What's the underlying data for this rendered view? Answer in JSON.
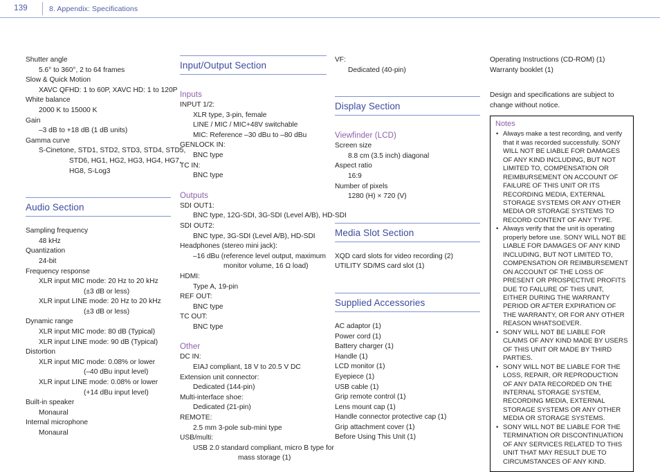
{
  "header": {
    "page_number": "139",
    "title": "8. Appendix: Specifications"
  },
  "column1": {
    "entries": [
      {
        "label": "Shutter angle",
        "values": [
          "5.6° to 360°, 2 to 64 frames"
        ]
      },
      {
        "label": "Slow & Quick Motion",
        "values": [
          "XAVC QFHD: 1 to 60P, XAVC HD: 1 to 120P"
        ]
      },
      {
        "label": "White balance",
        "values": [
          "2000 K to 15000 K"
        ]
      },
      {
        "label": "Gain",
        "values": [
          "–3 dB to +18 dB (1 dB units)"
        ]
      },
      {
        "label": "Gamma curve",
        "values": [
          "S-Cinetone, STD1, STD2, STD3, STD4, STD5,"
        ],
        "continuations": [
          "STD6, HG1, HG2, HG3, HG4, HG7,",
          "HG8, S-Log3"
        ]
      }
    ],
    "audio_section": {
      "heading": "Audio Section",
      "entries": [
        {
          "label": "Sampling frequency",
          "values": [
            "48 kHz"
          ]
        },
        {
          "label": "Quantization",
          "values": [
            "24-bit"
          ]
        },
        {
          "label": "Frequency response",
          "values": [
            "XLR input MIC mode: 20 Hz to 20 kHz"
          ],
          "continuations": [
            "(±3 dB or less)"
          ],
          "values2": [
            "XLR input LINE mode: 20 Hz to 20 kHz"
          ],
          "continuations2": [
            "(±3 dB or less)"
          ]
        },
        {
          "label": "Dynamic range",
          "values": [
            "XLR input MIC mode: 80 dB (Typical)",
            "XLR input LINE mode: 90 dB (Typical)"
          ]
        },
        {
          "label": "Distortion",
          "values": [
            "XLR input MIC mode: 0.08% or lower"
          ],
          "continuations": [
            "(–40 dBu input level)"
          ],
          "values2": [
            "XLR input LINE mode: 0.08% or lower"
          ],
          "continuations2": [
            "(+14 dBu input level)"
          ]
        },
        {
          "label": "Built-in speaker",
          "values": [
            "Monaural"
          ]
        },
        {
          "label": "Internal microphone",
          "values": [
            "Monaural"
          ]
        }
      ]
    }
  },
  "column2": {
    "heading": "Input/Output Section",
    "inputs": {
      "subheading": "Inputs",
      "entries": [
        {
          "label": "INPUT 1/2:",
          "values": [
            "XLR type, 3-pin, female",
            "LINE / MIC / MIC+48V switchable",
            "MIC: Reference –30 dBu to –80 dBu"
          ]
        },
        {
          "label": "GENLOCK IN:",
          "values": [
            "BNC type"
          ]
        },
        {
          "label": "TC IN:",
          "values": [
            "BNC type"
          ]
        }
      ]
    },
    "outputs": {
      "subheading": "Outputs",
      "entries": [
        {
          "label": "SDI OUT1:",
          "values": [
            "BNC type, 12G-SDI, 3G-SDI (Level A/B), HD-SDI"
          ]
        },
        {
          "label": "SDI OUT2:",
          "values": [
            "BNC type, 3G-SDI (Level A/B), HD-SDI"
          ]
        },
        {
          "label": "Headphones (stereo mini jack):",
          "values": [
            "–16 dBu (reference level output, maximum"
          ],
          "continuations": [
            "monitor volume, 16 Ω load)"
          ]
        },
        {
          "label": "HDMI:",
          "values": [
            "Type A, 19-pin"
          ]
        },
        {
          "label": "REF OUT:",
          "values": [
            "BNC type"
          ]
        },
        {
          "label": "TC OUT:",
          "values": [
            "BNC type"
          ]
        }
      ]
    },
    "other": {
      "subheading": "Other",
      "entries": [
        {
          "label": "DC IN:",
          "values": [
            "EIAJ compliant, 18 V to 20.5 V DC"
          ]
        },
        {
          "label": "Extension unit connector:",
          "values": [
            "Dedicated (144-pin)"
          ]
        },
        {
          "label": "Multi-interface shoe:",
          "values": [
            "Dedicated (21-pin)"
          ]
        },
        {
          "label": "REMOTE:",
          "values": [
            "2.5 mm 3-pole sub-mini type"
          ]
        },
        {
          "label": "USB/multi:",
          "values": [
            "USB 2.0 standard compliant, micro B type for"
          ],
          "continuations": [
            "mass storage (1)"
          ]
        }
      ]
    }
  },
  "column3": {
    "vf": {
      "label": "VF:",
      "value": "Dedicated (40-pin)"
    },
    "display_section": {
      "heading": "Display Section",
      "subheading": "Viewfinder (LCD)",
      "entries": [
        {
          "label": "Screen size",
          "values": [
            "8.8 cm (3.5 inch) diagonal"
          ]
        },
        {
          "label": "Aspect ratio",
          "values": [
            "16:9"
          ]
        },
        {
          "label": "Number of pixels",
          "values": [
            "1280 (H) × 720 (V)"
          ]
        }
      ]
    },
    "media_slot_section": {
      "heading": "Media Slot Section",
      "lines": [
        "XQD card slots for video recording (2)",
        "UTILITY SD/MS card slot (1)"
      ]
    },
    "supplied_accessories": {
      "heading": "Supplied Accessories",
      "items": [
        "AC adaptor (1)",
        "Power cord (1)",
        "Battery charger (1)",
        "Handle (1)",
        "LCD monitor (1)",
        "Eyepiece (1)",
        "USB cable (1)",
        "Grip remote control (1)",
        "Lens mount cap (1)",
        "Handle connector protective cap (1)",
        "Grip attachment cover (1)",
        "Before Using This Unit (1)"
      ]
    }
  },
  "column4": {
    "items": [
      "Operating Instructions (CD-ROM) (1)",
      "Warranty booklet (1)"
    ],
    "disclaimer": "Design and specifications are subject to change without notice.",
    "notes": {
      "title": "Notes",
      "bullet_glyph": "•",
      "items": [
        "Always make a test recording, and verify that it was recorded successfully. SONY WILL NOT BE LIABLE FOR DAMAGES OF ANY KIND INCLUDING, BUT NOT LIMITED TO, COMPENSATION OR REIMBURSEMENT ON ACCOUNT OF FAILURE OF THIS UNIT OR ITS RECORDING MEDIA, EXTERNAL STORAGE SYSTEMS OR ANY OTHER MEDIA OR STORAGE SYSTEMS TO RECORD CONTENT OF ANY TYPE.",
        "Always verify that the unit is operating properly before use. SONY WILL NOT BE LIABLE FOR DAMAGES OF ANY KIND INCLUDING, BUT NOT LIMITED TO, COMPENSATION OR REIMBURSEMENT ON ACCOUNT OF THE LOSS OF PRESENT OR PROSPECTIVE PROFITS DUE TO FAILURE OF THIS UNIT, EITHER DURING THE WARRANTY PERIOD OR AFTER EXPIRATION OF THE WARRANTY, OR FOR ANY OTHER REASON WHATSOEVER.",
        "SONY WILL NOT BE LIABLE FOR CLAIMS OF ANY KIND MADE BY USERS OF THIS UNIT OR MADE BY THIRD PARTIES.",
        "SONY WILL NOT BE LIABLE FOR THE LOSS, REPAIR, OR REPRODUCTION OF ANY DATA RECORDED ON THE INTERNAL STORAGE SYSTEM, RECORDING MEDIA, EXTERNAL STORAGE SYSTEMS OR ANY OTHER MEDIA OR STORAGE SYSTEMS.",
        "SONY WILL NOT BE LIABLE FOR THE TERMINATION OR DISCONTINUATION OF ANY SERVICES RELATED TO THIS UNIT THAT MAY RESULT DUE TO CIRCUMSTANCES OF ANY KIND."
      ]
    }
  },
  "colors": {
    "heading_blue": "#3b4a9c",
    "subheading_purple": "#8c5fa8",
    "header_blue": "#4c5ba8",
    "rule_blue": "#7f93cf",
    "body_text": "#231f20"
  }
}
